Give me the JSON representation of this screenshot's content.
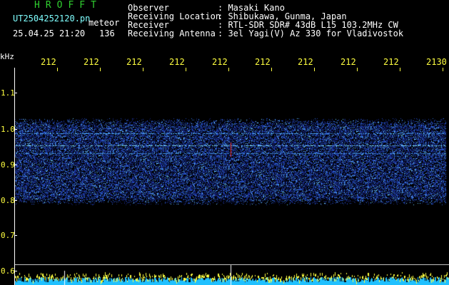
{
  "header": {
    "program_title": "HROFFT",
    "file_name": "UT2504252120.pn",
    "tag": "meteor",
    "datetime": "25.04.25 21:20",
    "count": "136",
    "observer_label": "Observer",
    "observer_value": ": Masaki Kano",
    "location_label": "Receiving Location",
    "location_value": ": Shibukawa, Gunma, Japan",
    "receiver_label": "Receiver",
    "receiver_value": ": RTL-SDR SDR# 43dB L15 103.2MHz CW",
    "antenna_label": "Receiving Antenna",
    "antenna_value": ": 3el Yagi(V) Az 330 for Vladivostok"
  },
  "axis": {
    "unit_label": "kHz",
    "y_ticks": [
      "1.1",
      "1.0",
      "0.9",
      "0.8",
      "0.7",
      "0.6"
    ],
    "time_ticks": [
      "212",
      "212",
      "212",
      "212",
      "212",
      "212",
      "212",
      "212",
      "212",
      "2130"
    ]
  },
  "colors": {
    "background": "#000000",
    "title": "#30d030",
    "filename": "#80ffff",
    "axis_text": "#ffff40",
    "noise_dark": "#1a2a8a",
    "noise_bright": "#60c0ff"
  }
}
